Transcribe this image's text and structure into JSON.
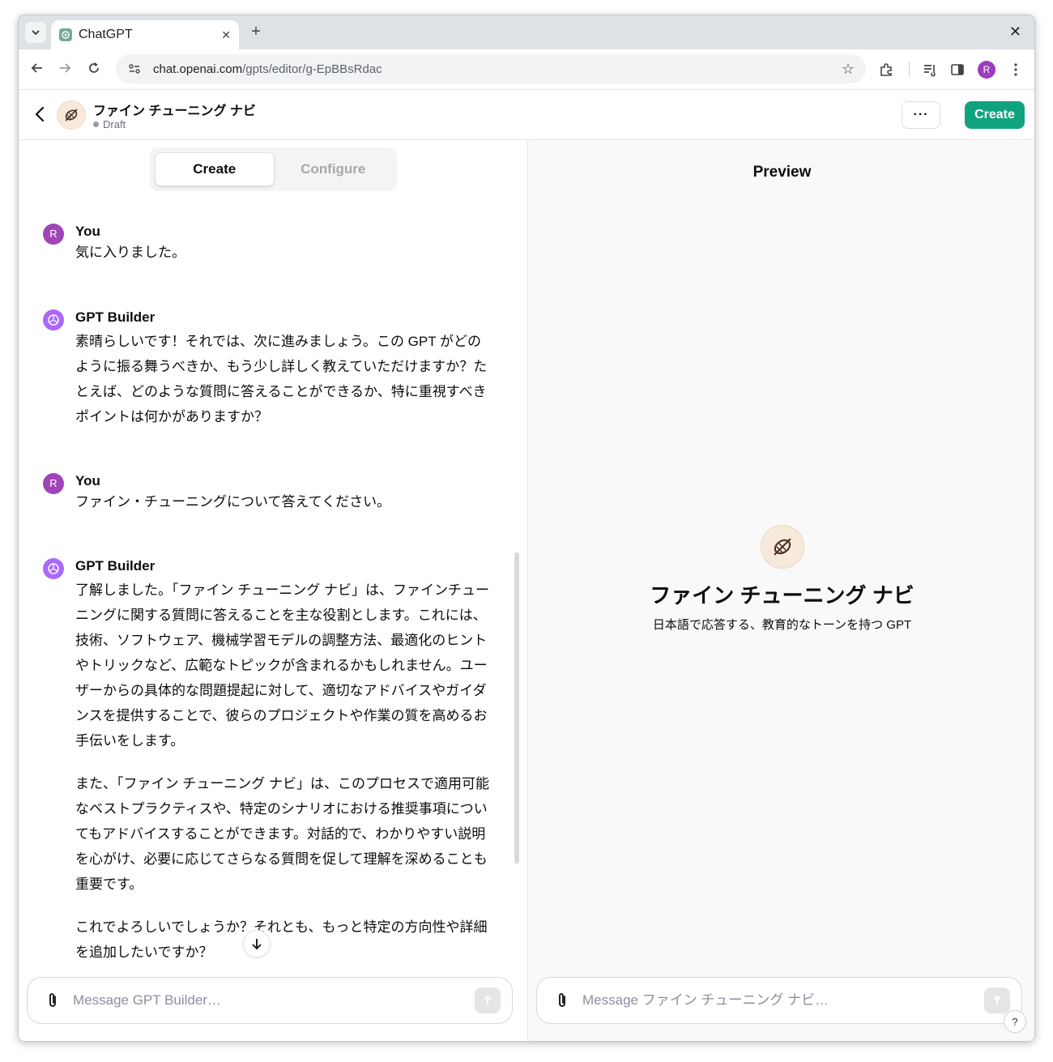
{
  "browser": {
    "tab_title": "ChatGPT",
    "url_domain": "chat.openai.com",
    "url_path": "/gpts/editor/g-EpBBsRdac",
    "profile_initial": "R"
  },
  "header": {
    "gpt_name": "ファイン チューニング ナビ",
    "status": "Draft",
    "more_label": "···",
    "create_label": "Create"
  },
  "left": {
    "tabs": [
      {
        "label": "Create"
      },
      {
        "label": "Configure"
      }
    ],
    "messages": [
      {
        "author": "You",
        "initial": "R",
        "paragraphs": [
          "気に入りました。"
        ]
      },
      {
        "author": "GPT Builder",
        "paragraphs": [
          "素晴らしいです！それでは、次に進みましょう。この GPT がどのように振る舞うべきか、もう少し詳しく教えていただけますか？たとえば、どのような質問に答えることができるか、特に重視すべきポイントは何かがありますか？"
        ]
      },
      {
        "author": "You",
        "initial": "R",
        "paragraphs": [
          "ファイン・チューニングについて答えてください。"
        ]
      },
      {
        "author": "GPT Builder",
        "paragraphs": [
          "了解しました。「ファイン チューニング ナビ」は、ファインチューニングに関する質問に答えることを主な役割とします。これには、技術、ソフトウェア、機械学習モデルの調整方法、最適化のヒントやトリックなど、広範なトピックが含まれるかもしれません。ユーザーからの具体的な問題提起に対して、適切なアドバイスやガイダンスを提供することで、彼らのプロジェクトや作業の質を高めるお手伝いをします。",
          "また、「ファイン チューニング ナビ」は、このプロセスで適用可能なベストプラクティスや、特定のシナリオにおける推奨事項についてもアドバイスすることができます。対話的で、わかりやすい説明を心がけ、必要に応じてさらなる質問を促して理解を深めることも重要です。",
          "これでよろしいでしょうか？それとも、もっと特定の方向性や詳細を追加したいですか？"
        ]
      }
    ],
    "composer_placeholder": "Message GPT Builder…"
  },
  "right": {
    "title": "Preview",
    "gpt_name": "ファイン チューニング ナビ",
    "gpt_description": "日本語で応答する、教育的なトーンを持つ GPT",
    "composer_placeholder": "Message ファイン チューニング ナビ…",
    "help_label": "?"
  },
  "colors": {
    "accent_green": "#10a37f",
    "user_avatar": "#a044b8",
    "builder_avatar": "#ab68ff"
  }
}
